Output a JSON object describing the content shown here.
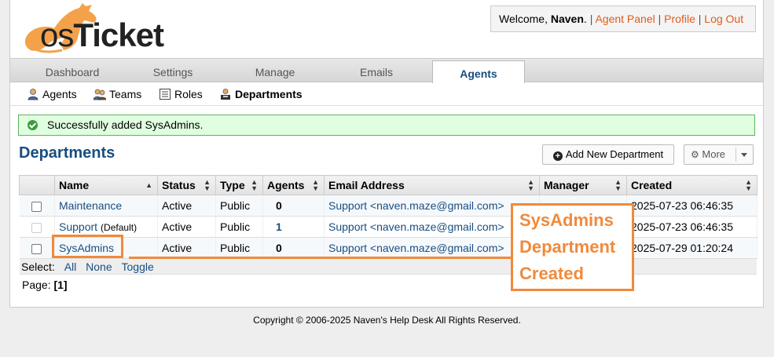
{
  "header": {
    "logo_text_os": "os",
    "logo_text_ticket": "Ticket",
    "welcome_prefix": "Welcome, ",
    "user_name": "Naven",
    "welcome_suffix": ".",
    "links": [
      "Agent Panel",
      "Profile",
      "Log Out"
    ],
    "separator": "|"
  },
  "nav": {
    "tabs": [
      {
        "label": "Dashboard"
      },
      {
        "label": "Settings"
      },
      {
        "label": "Manage"
      },
      {
        "label": "Emails"
      },
      {
        "label": "Agents"
      }
    ],
    "active": "Agents"
  },
  "subnav": {
    "items": [
      {
        "label": "Agents",
        "icon": "agent-icon"
      },
      {
        "label": "Teams",
        "icon": "teams-icon"
      },
      {
        "label": "Roles",
        "icon": "roles-icon"
      },
      {
        "label": "Departments",
        "icon": "departments-icon"
      }
    ],
    "active": "Departments"
  },
  "message": {
    "text": "Successfully added SysAdmins.",
    "icon": "check-circle-icon",
    "color": "#3b9c3b"
  },
  "page": {
    "title": "Departments",
    "add_button": "Add New Department",
    "more_button": "More"
  },
  "table": {
    "headers": [
      "Name",
      "Status",
      "Type",
      "Agents",
      "Email Address",
      "Manager",
      "Created"
    ],
    "rows": [
      {
        "name": "Maintenance",
        "default": "",
        "status": "Active",
        "type": "Public",
        "agents": "0",
        "email": "Support <naven.maze@gmail.com>",
        "manager": "",
        "created": "2025-07-23 06:46:35"
      },
      {
        "name": "Support",
        "default": "(Default)",
        "status": "Active",
        "type": "Public",
        "agents": "1",
        "email": "Support <naven.maze@gmail.com>",
        "manager": "",
        "created": "2025-07-23 06:46:35"
      },
      {
        "name": "SysAdmins",
        "default": "",
        "status": "Active",
        "type": "Public",
        "agents": "0",
        "email": "Support <naven.maze@gmail.com>",
        "manager": "",
        "created": "2025-07-29 01:20:24"
      }
    ]
  },
  "select_bar": {
    "label": "Select:",
    "options": [
      "All",
      "None",
      "Toggle"
    ]
  },
  "pager": {
    "label": "Page:",
    "current": "[1]"
  },
  "footer": {
    "text": "Copyright © 2006-2025 Naven's Help Desk All Rights Reserved."
  },
  "annotation": {
    "lines": [
      "SysAdmins",
      "Department",
      "Created"
    ],
    "color": "#f08a3c"
  },
  "colors": {
    "link": "#184e81",
    "header_link": "#e15b1b",
    "success_bg": "#e0ffe0",
    "success_border": "#5ab65a"
  }
}
